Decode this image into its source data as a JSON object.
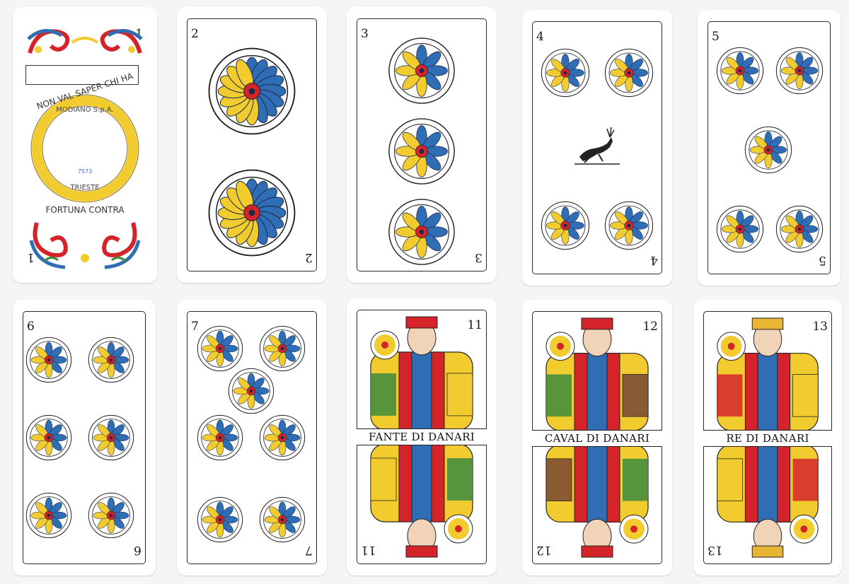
{
  "cards": [
    {
      "rank": "1",
      "type": "ace",
      "ring_top_text": "NON VAL SAPER CHI HA",
      "ring_inner_text": "MODIANO S.p.A.",
      "ring_code": "7573",
      "ring_lower_text": "TRIESTE",
      "ring_bottom_text": "FORTUNA CONTRA"
    },
    {
      "rank": "2",
      "type": "pips"
    },
    {
      "rank": "3",
      "type": "pips"
    },
    {
      "rank": "4",
      "type": "pips"
    },
    {
      "rank": "5",
      "type": "pips"
    },
    {
      "rank": "6",
      "type": "pips"
    },
    {
      "rank": "7",
      "type": "pips"
    },
    {
      "rank": "11",
      "type": "court",
      "name": "FANTE DI DANARI"
    },
    {
      "rank": "12",
      "type": "court",
      "name": "CAVAL DI DANARI"
    },
    {
      "rank": "13",
      "type": "court",
      "name": "RE DI DANARI"
    }
  ],
  "colors": {
    "blue": "#2f6db5",
    "yellow": "#f2cc2e",
    "red": "#d4242a",
    "green": "#3d8a3e",
    "brown": "#8a5a32",
    "gold": "#e8b534"
  },
  "icons": {
    "coin": "danari-coin-icon",
    "stag": "leaping-stag-icon",
    "ace_ornament": "scroll-ornament-icon"
  }
}
